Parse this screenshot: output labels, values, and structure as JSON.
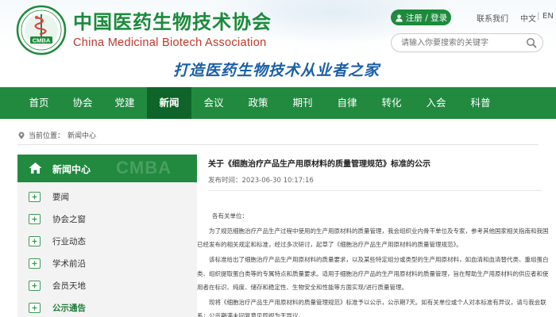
{
  "header": {
    "org_name_cn": "中国医药生物技术协会",
    "org_name_en": "China Medicinal Biotech Association",
    "logo_text": "CMBA",
    "slogan": "打造医药生物技术从业者之家",
    "login_label": "注册 / 登录",
    "contact_label": "联系我们",
    "lang_cn": "中文",
    "lang_sep": "|",
    "lang_en": "EN",
    "search": {
      "placeholder": "请输入你要搜索的关键字"
    }
  },
  "nav": {
    "items": [
      "首页",
      "协会",
      "党建",
      "新闻",
      "会议",
      "政策",
      "期刊",
      "自律",
      "转化",
      "入会",
      "科普"
    ],
    "active_index": 3
  },
  "breadcrumb": {
    "label": "当前位置：",
    "current": "新闻中心"
  },
  "sidebar": {
    "title": "新闻中心",
    "watermark": "CMBA",
    "items": [
      "要闻",
      "协会之窗",
      "行业动态",
      "学术前沿",
      "会员天地",
      "公示通告"
    ],
    "active_index": 5
  },
  "article": {
    "title": "关于《细胞治疗产品生产用原材料的质量管理规范》标准的公示",
    "date_label": "发布时间：",
    "date": "2023-06-30 10:17:16",
    "greeting": "各有关单位：",
    "paragraphs": [
      "为了规范细胞治疗产品生产过程中使用的生产用原材料的质量管理，我会组织业内骨干单位及专家，参考其他国家相关指南和我国已经发布的相关规定和标准，经过多次研讨，起草了《细胞治疗产品生产用原材料的质量管理规范》。",
      "该标准给出了细胞治疗产品生产用原材料的质量要求，以及某些特定组分或类型的生产用原材料，如血清和血清替代类、重组蛋白类、组织提取蛋白类等的专属特点和质量要求。适用于细胞治疗产品的生产用原材料的质量管理，旨在帮助生产用原材料的供应者和使用者在标识、纯度、储存和稳定性、生物安全和性能等方面实现/进行质量管理。",
      "现将《细胞治疗产品生产用原材料的质量管理规范》标准予以公示，公示期7天。如有关单位或个人对本标准有异议，请与我会联系；公示期满未回复意见即视为无异议。"
    ]
  },
  "colors": {
    "brand_green": "#218a3f",
    "nav_active": "#0f6429",
    "slogan_blue": "#1a5fa8",
    "en_name_red": "#c0392b"
  },
  "icons": {
    "logo": "cmba-snake-emblem",
    "login": "user-icon",
    "search": "search-icon",
    "breadcrumb": "location-pin-icon",
    "sidebar_head": "home-icon",
    "sidebar_item": "plus-box-icon"
  }
}
